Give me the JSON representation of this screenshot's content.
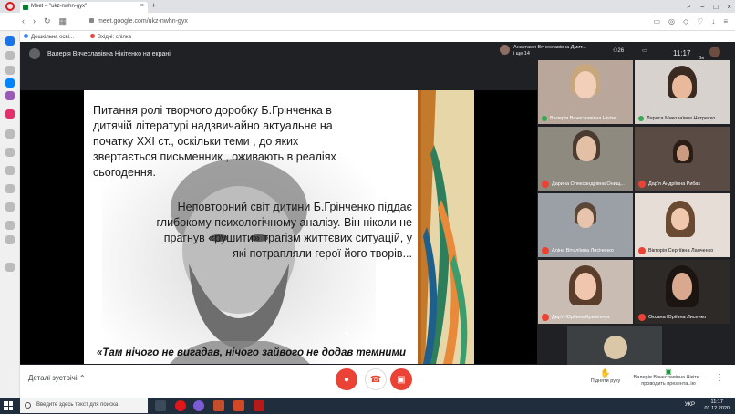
{
  "browser": {
    "tab_title": "Meet – \"ukz-nwhn-gyx\"",
    "url": "meet.google.com/ukz-nwhn-gyx",
    "bookmarks": [
      "Дошкільна осві...",
      "Вхідні: спілка"
    ]
  },
  "meet": {
    "presenter_title": "Валерія Вячеславівна Нікітенко на екрані",
    "top_user_name": "Анастасія Вячеславівна Дмит...",
    "top_user_sub": "і ще 14",
    "participants_count": "26",
    "chat_label": "",
    "clock": "11:17",
    "self_label": "Ви",
    "slide": {
      "para1": "Питання ролі творчого доробку Б.Грінченка в дитячій літературі надзвичайно актуальне на початку XXI ст., оскільки теми , до яких звертається письменник , оживають в реаліях сьогодення.",
      "para2": "Неповторний світ дитини Б.Грінченко піддає глибокому психологічному аналізу. Він ніколи не прагнув «рушити» трагізм життєвих ситуацій, у які потрапляли герої його творів...",
      "quote": "«Там нічого не вигадав, нічого зайвого не додав темними"
    },
    "participants": [
      {
        "name": "Валерія Вячеславівна Нікіте...",
        "muted": false
      },
      {
        "name": "Лариса Миколаївна Нетреско",
        "muted": false
      },
      {
        "name": "Дарина Олександрівна Онищ...",
        "muted": true
      },
      {
        "name": "Дар'я Андріївна Рибак",
        "muted": true
      },
      {
        "name": "Аліна Віталіївна Лисіченко",
        "muted": true
      },
      {
        "name": "Вікторія Сергіївна Ланченко",
        "muted": true
      },
      {
        "name": "Дар'я Юріївна Кривенчук",
        "muted": true
      },
      {
        "name": "Оксана Юріївна Лисенко",
        "muted": true
      }
    ],
    "details_label": "Деталі зустрічі",
    "raise_hand_label": "Підняти руку",
    "presenting_label": "Валерія Вячеславівна Нікіте... проводить презента..ію"
  },
  "taskbar": {
    "search_placeholder": "Введите здесь текст для поиска",
    "lang": "УКР",
    "time": "11:17",
    "date": "01.12.2020"
  },
  "colors": {
    "meet_bg": "#202124",
    "end_call": "#ea4335",
    "taskbar": "#1f2d3d"
  }
}
